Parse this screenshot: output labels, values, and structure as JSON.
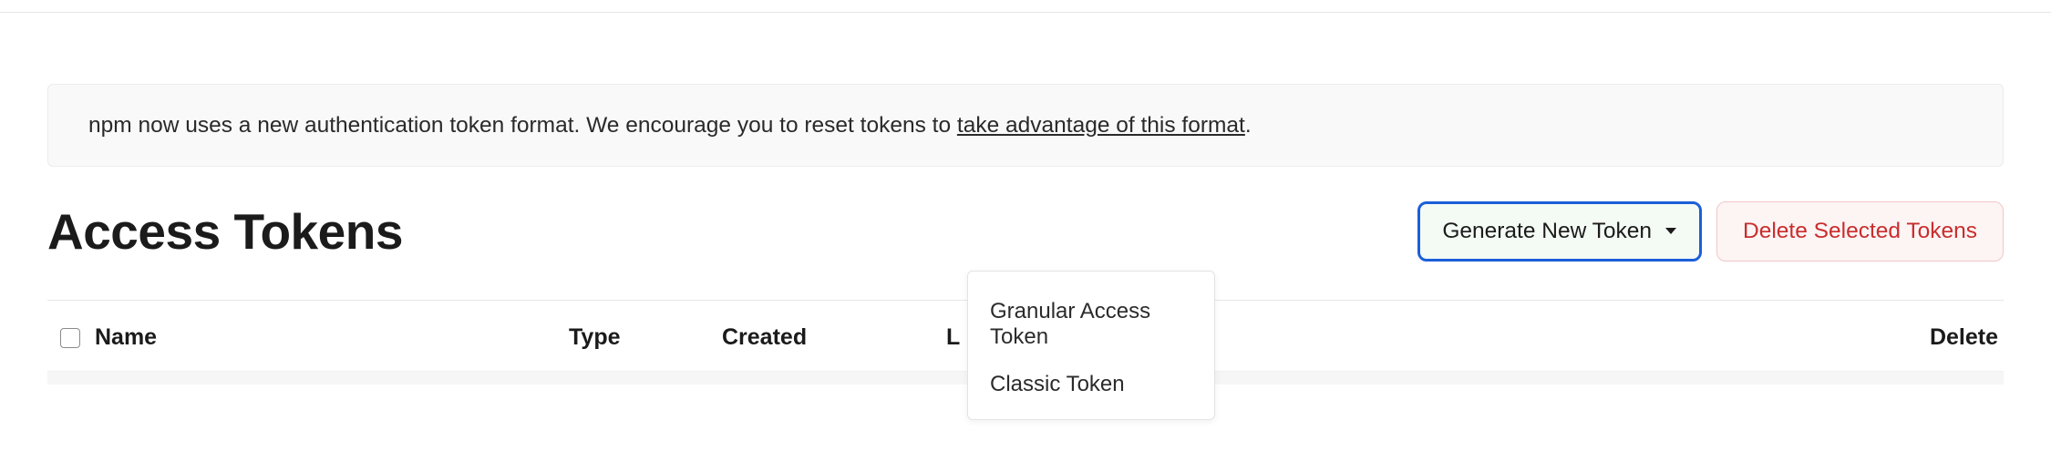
{
  "notice": {
    "prefix": "npm now uses a new authentication token format. We encourage you to reset tokens to ",
    "link_text": "take advantage of this format",
    "suffix": "."
  },
  "header": {
    "title": "Access Tokens"
  },
  "actions": {
    "generate_label": "Generate New Token",
    "delete_label": "Delete Selected Tokens"
  },
  "dropdown": {
    "items": [
      {
        "label": "Granular Access Token"
      },
      {
        "label": "Classic Token"
      }
    ]
  },
  "table": {
    "columns": {
      "name": "Name",
      "type": "Type",
      "created": "Created",
      "l": "L",
      "delete": "Delete"
    }
  }
}
